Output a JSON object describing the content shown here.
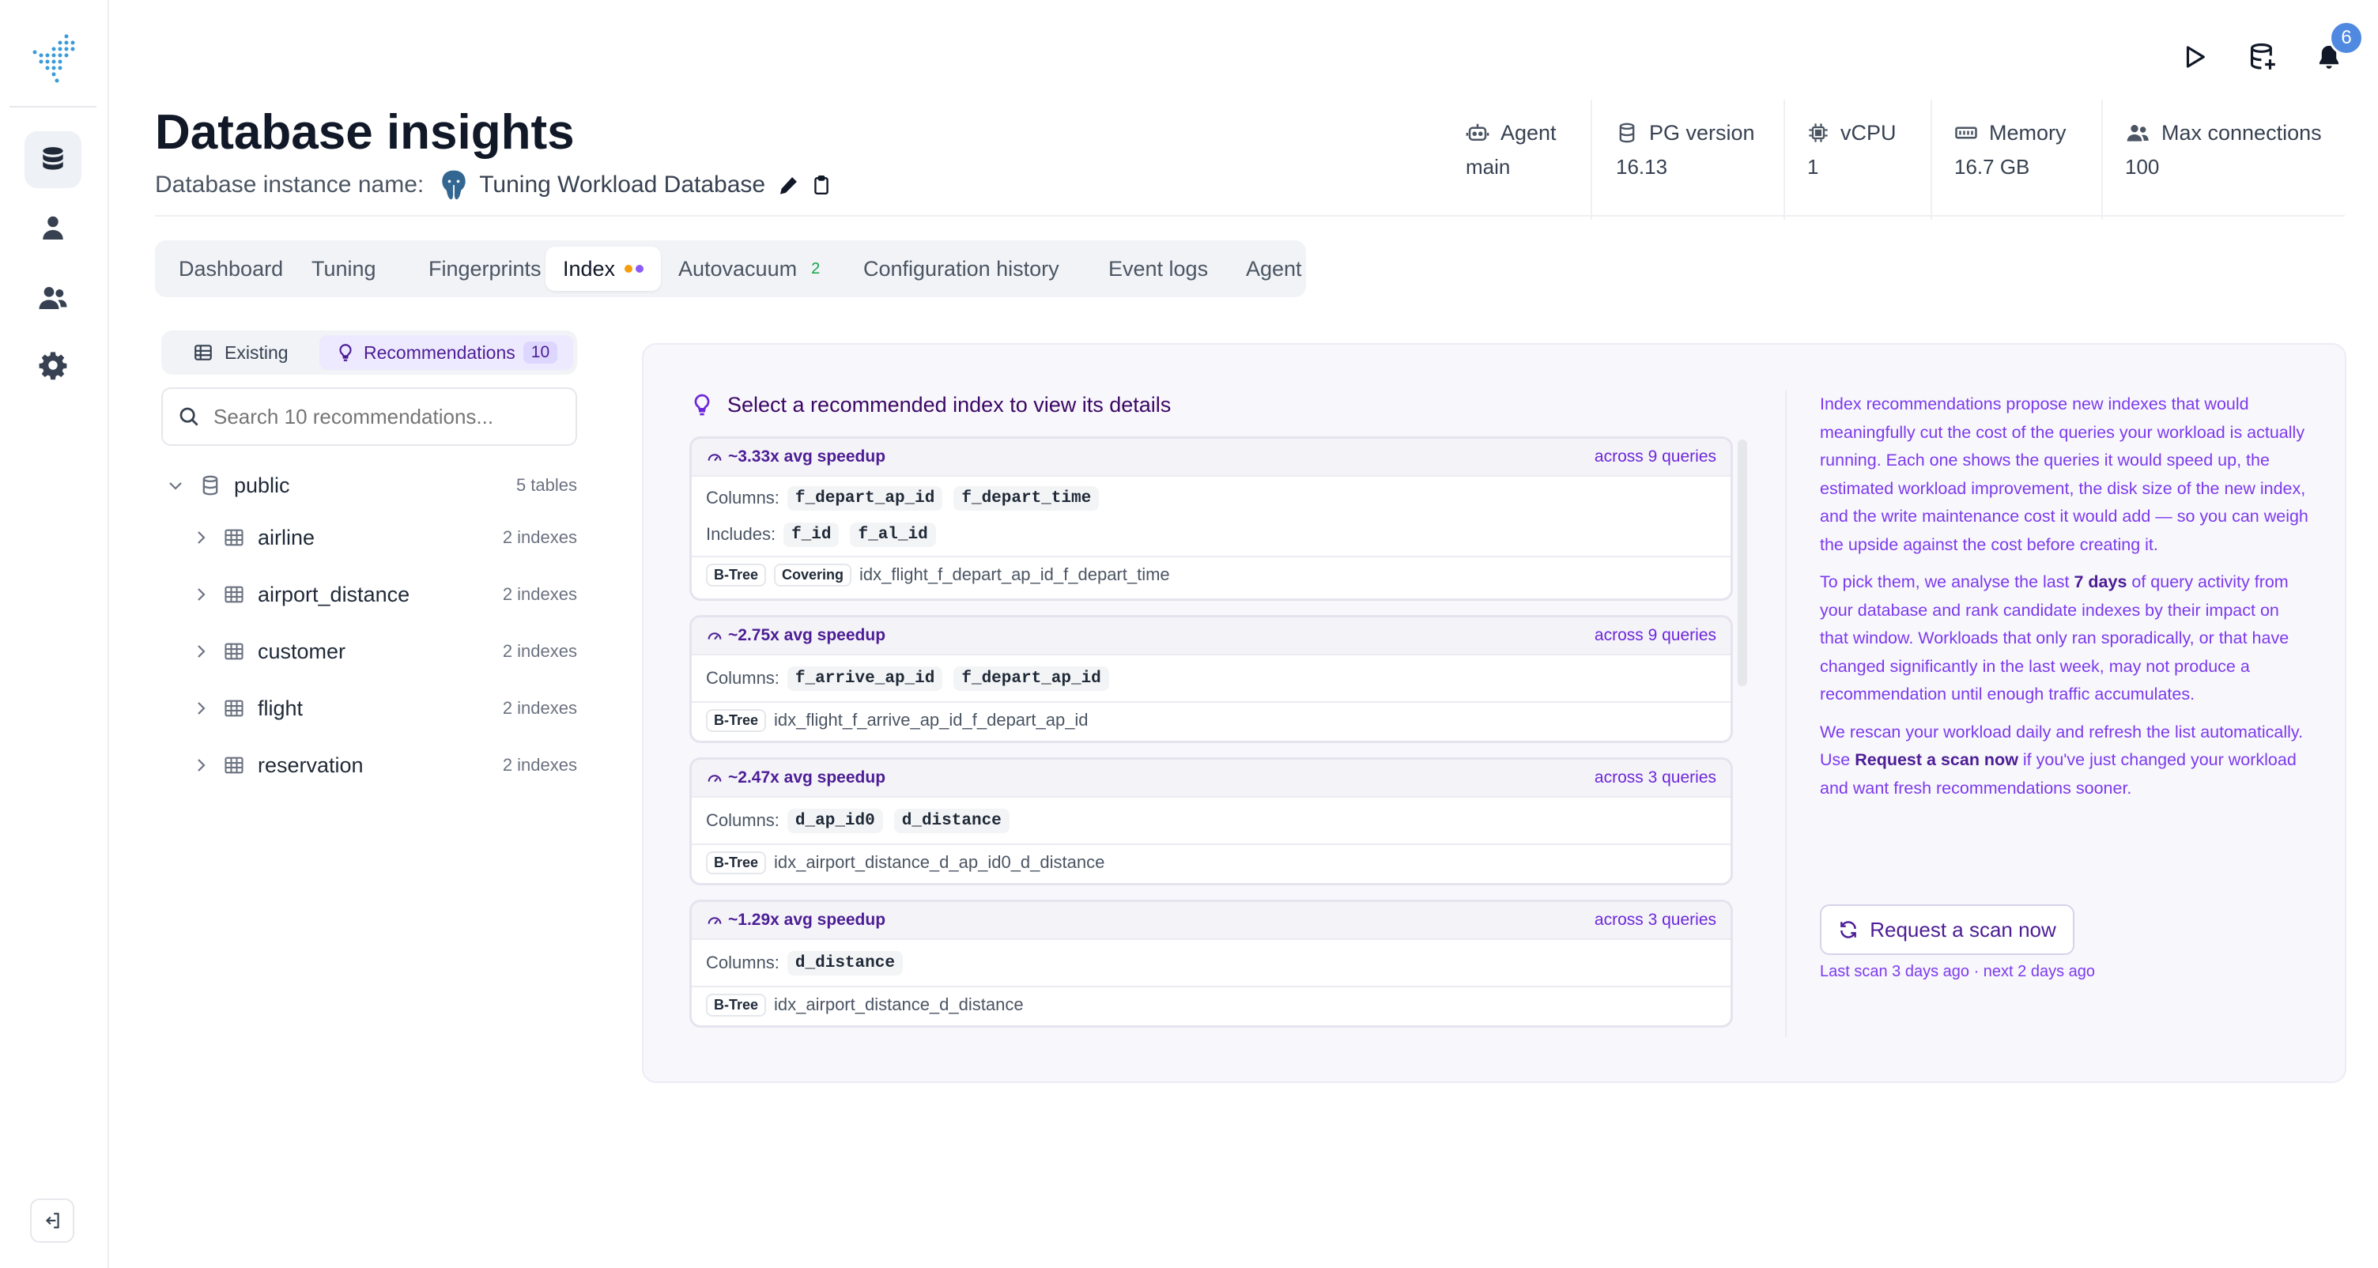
{
  "app": {
    "notifications_count": "6"
  },
  "header": {
    "title": "Database insights",
    "instance_label": "Database instance name:",
    "instance_name": "Tuning Workload Database"
  },
  "stats": [
    {
      "label": "Agent",
      "value": "main",
      "icon": "robot-icon"
    },
    {
      "label": "PG version",
      "value": "16.13",
      "icon": "database-icon"
    },
    {
      "label": "vCPU",
      "value": "1",
      "icon": "cpu-icon"
    },
    {
      "label": "Memory",
      "value": "16.7 GB",
      "icon": "memory-icon"
    },
    {
      "label": "Max connections",
      "value": "100",
      "icon": "users-icon"
    }
  ],
  "tabs": [
    {
      "label": "Dashboard"
    },
    {
      "label": "Tuning"
    },
    {
      "label": "Fingerprints"
    },
    {
      "label": "Index",
      "active": true
    },
    {
      "label": "Autovacuum",
      "count": "2"
    },
    {
      "label": "Configuration history"
    },
    {
      "label": "Event logs"
    },
    {
      "label": "Agent"
    }
  ],
  "index_view": {
    "existing_label": "Existing",
    "recommendations_label": "Recommendations",
    "recommendations_count": "10",
    "search_placeholder": "Search 10 recommendations...",
    "schema": {
      "name": "public",
      "meta": "5 tables"
    },
    "tables": [
      {
        "name": "airline",
        "meta": "2 indexes"
      },
      {
        "name": "airport_distance",
        "meta": "2 indexes"
      },
      {
        "name": "customer",
        "meta": "2 indexes"
      },
      {
        "name": "flight",
        "meta": "2 indexes"
      },
      {
        "name": "reservation",
        "meta": "2 indexes"
      }
    ]
  },
  "recommendations": {
    "select_prompt": "Select a recommended index to view its details",
    "columns_label": "Columns:",
    "includes_label": "Includes:",
    "cards": [
      {
        "speedup": "~3.33x avg speedup",
        "queries": "across 9 queries",
        "columns": [
          "f_depart_ap_id",
          "f_depart_time"
        ],
        "includes": [
          "f_id",
          "f_al_id"
        ],
        "type": "B-Tree",
        "extra": "Covering",
        "index_name": "idx_flight_f_depart_ap_id_f_depart_time"
      },
      {
        "speedup": "~2.75x avg speedup",
        "queries": "across 9 queries",
        "columns": [
          "f_arrive_ap_id",
          "f_depart_ap_id"
        ],
        "type": "B-Tree",
        "index_name": "idx_flight_f_arrive_ap_id_f_depart_ap_id"
      },
      {
        "speedup": "~2.47x avg speedup",
        "queries": "across 3 queries",
        "columns": [
          "d_ap_id0",
          "d_distance"
        ],
        "type": "B-Tree",
        "index_name": "idx_airport_distance_d_ap_id0_d_distance"
      },
      {
        "speedup": "~1.29x avg speedup",
        "queries": "across 3 queries",
        "columns": [
          "d_distance"
        ],
        "type": "B-Tree",
        "index_name": "idx_airport_distance_d_distance"
      }
    ]
  },
  "info": {
    "p1": "Index recommendations propose new indexes that would meaningfully cut the cost of the queries your workload is actually running. Each one shows the queries it would speed up, the estimated workload improvement, the disk size of the new index, and the write maintenance cost it would add — so you can weigh the upside against the cost before creating it.",
    "p2_a": "To pick them, we analyse the last ",
    "p2_b": "7 days",
    "p2_c": " of query activity from your database and rank candidate indexes by their impact on that window. Workloads that only ran sporadically, or that have changed significantly in the last week, may not produce a recommendation until enough traffic accumulates.",
    "p3_a": "We rescan your workload daily and refresh the list automatically. Use ",
    "p3_b": "Request a scan now",
    "p3_c": " if you've just changed your workload and want fresh recommendations sooner.",
    "scan_button": "Request a scan now",
    "last_scan": "Last scan 3 days ago · next 2 days ago"
  }
}
